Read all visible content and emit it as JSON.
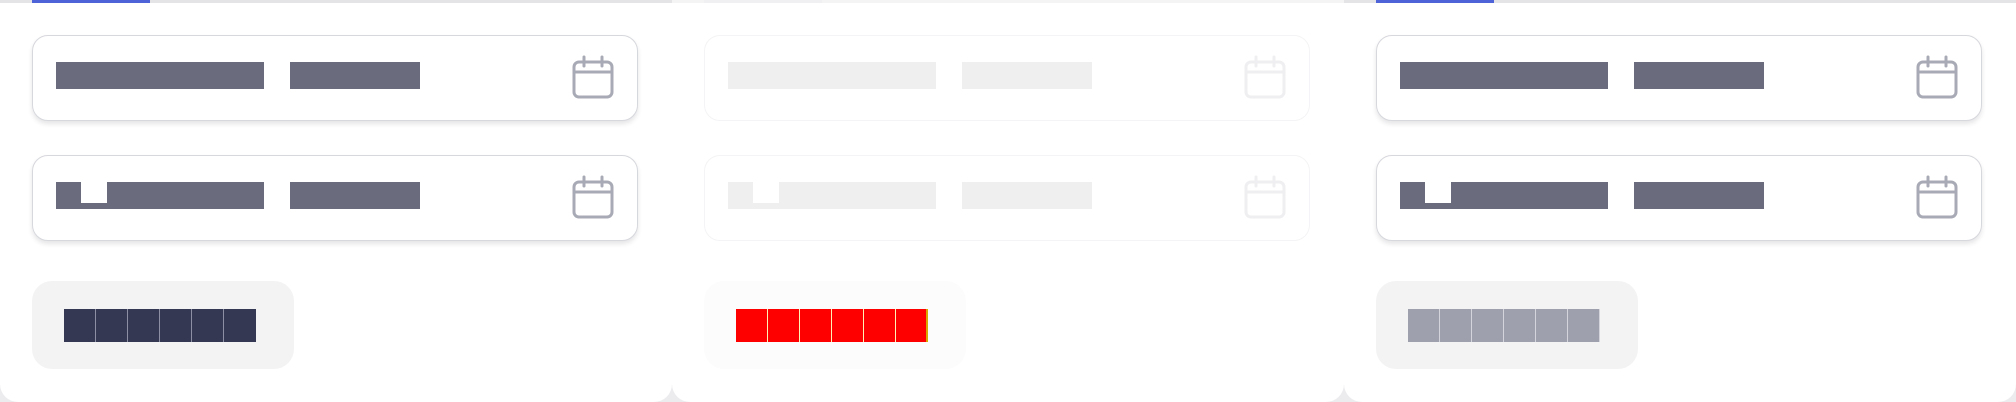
{
  "panels": [
    {
      "name": "default",
      "fields": [
        {
          "name": "date-range-field-1",
          "has_notch": false
        },
        {
          "name": "date-range-field-2",
          "has_notch": true
        }
      ],
      "code_cells": 6,
      "cell_color": "#353852",
      "accent_color": "#4f63d9"
    },
    {
      "name": "disabled",
      "fields": [
        {
          "name": "date-range-field-1",
          "has_notch": false
        },
        {
          "name": "date-range-field-2",
          "has_notch": true
        }
      ],
      "code_cells": 6,
      "cell_color": "#ff0000",
      "accent_color": "#f0f0f2"
    },
    {
      "name": "default-alt",
      "fields": [
        {
          "name": "date-range-field-1",
          "has_notch": false
        },
        {
          "name": "date-range-field-2",
          "has_notch": true
        }
      ],
      "code_cells": 6,
      "cell_color": "#9fa0ad",
      "accent_color": "#4f63d9"
    }
  ],
  "icons": {
    "calendar": "calendar-icon"
  }
}
